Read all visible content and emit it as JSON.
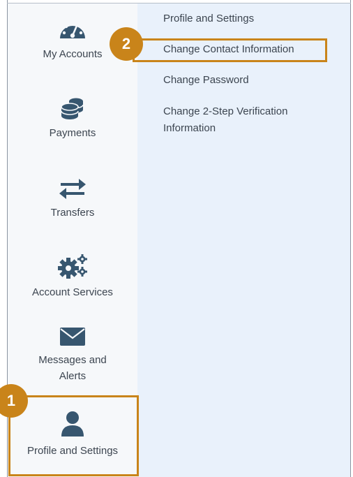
{
  "sidebar": {
    "items": [
      {
        "label": "My Accounts",
        "icon": "gauge-icon"
      },
      {
        "label": "Payments",
        "icon": "coins-icon"
      },
      {
        "label": "Transfers",
        "icon": "transfer-arrows-icon"
      },
      {
        "label": "Account Services",
        "icon": "gears-icon"
      },
      {
        "label": "Messages and\nAlerts",
        "icon": "envelope-icon"
      },
      {
        "label": "Profile and Settings",
        "icon": "person-icon"
      }
    ]
  },
  "submenu": {
    "title": "Profile and Settings",
    "items": [
      {
        "label": "Change Contact Information"
      },
      {
        "label": "Change Password"
      },
      {
        "label": "Change 2-Step Verification\nInformation"
      }
    ]
  },
  "callouts": [
    {
      "number": "1"
    },
    {
      "number": "2"
    }
  ],
  "colors": {
    "accent": "#c9841a",
    "icon": "#37566f",
    "sidebar_bg": "#f6f8fa",
    "submenu_bg": "#e9f1fb",
    "text": "#3c4550"
  }
}
